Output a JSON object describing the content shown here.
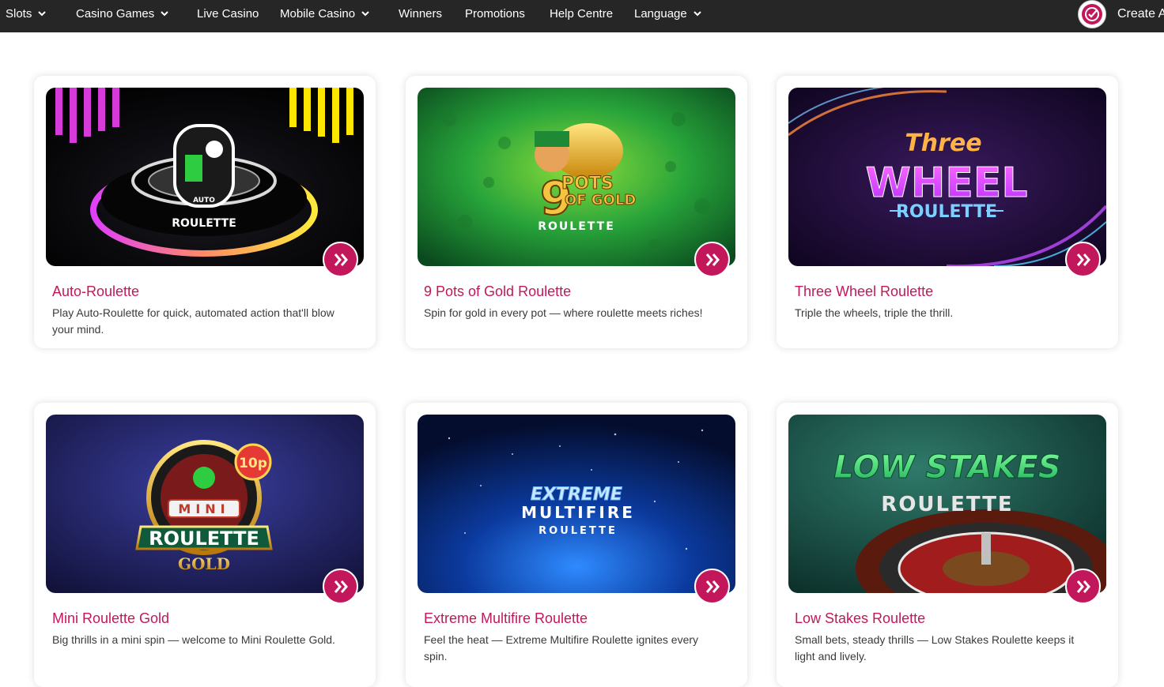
{
  "nav": {
    "items": [
      {
        "label": "Slots",
        "dropdown": true
      },
      {
        "label": "Casino Games",
        "dropdown": true
      },
      {
        "label": "Live Casino",
        "dropdown": false
      },
      {
        "label": "Mobile Casino",
        "dropdown": true
      },
      {
        "label": "Winners",
        "dropdown": false
      },
      {
        "label": "Promotions",
        "dropdown": false
      },
      {
        "label": "Help Centre",
        "dropdown": false
      },
      {
        "label": "Language",
        "dropdown": true
      }
    ],
    "create_label": "Create A",
    "background": "#262626",
    "logo_icon": "check-circle-icon"
  },
  "accent_color": "#c2185b",
  "games": [
    {
      "title": "Auto-Roulette",
      "description": "Play Auto-Roulette for quick, automated action that'll blow your mind.",
      "art": {
        "line1": "AUTO",
        "line2": "ROULETTE"
      }
    },
    {
      "title": "9 Pots of Gold Roulette",
      "description": "Spin for gold in every pot — where roulette meets riches!",
      "art": {
        "line1": "9",
        "line2": "POTS",
        "line3": "OF GOLD",
        "line4": "ROULETTE"
      }
    },
    {
      "title": "Three Wheel Roulette",
      "description": "Triple the wheels, triple the thrill.",
      "art": {
        "line1": "Three",
        "line2": "WHEEL",
        "line3": "ROULETTE"
      }
    },
    {
      "title": "Mini Roulette Gold",
      "description": "Big thrills in a mini spin — welcome to Mini Roulette Gold.",
      "art": {
        "badge": "10p",
        "line1": "MINI",
        "line2": "ROULETTE",
        "line3": "GOLD"
      }
    },
    {
      "title": "Extreme Multifire Roulette",
      "description": "Feel the heat — Extreme Multifire Roulette ignites every spin.",
      "art": {
        "line1": "EXTREME",
        "line2": "MULTIFIRE",
        "line3": "ROULETTE"
      }
    },
    {
      "title": "Low Stakes Roulette",
      "description": "Small bets, steady thrills — Low Stakes Roulette keeps it light and lively.",
      "art": {
        "line1": "LOW STAKES",
        "line2": "ROULETTE"
      }
    }
  ],
  "play_icon": "double-chevron-right-icon"
}
